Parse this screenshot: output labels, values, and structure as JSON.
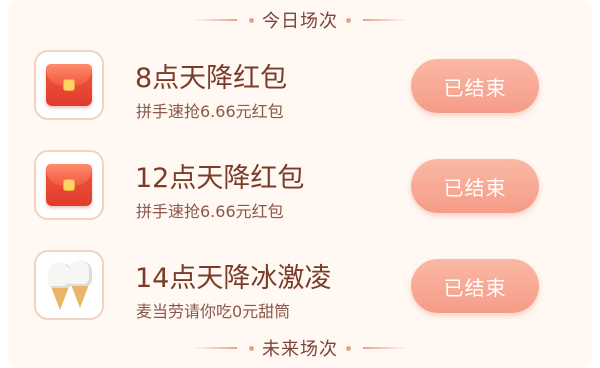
{
  "today_header": "今日场次",
  "future_header": "未来场次",
  "sessions": [
    {
      "title": "8点天降红包",
      "subtitle": "拼手速抢6.66元红包",
      "button": "已结束",
      "icon": "red-envelope-icon"
    },
    {
      "title": "12点天降红包",
      "subtitle": "拼手速抢6.66元红包",
      "button": "已结束",
      "icon": "red-envelope-icon"
    },
    {
      "title": "14点天降冰激凌",
      "subtitle": "麦当劳请你吃0元甜筒",
      "button": "已结束",
      "icon": "ice-cream-icon"
    }
  ],
  "colors": {
    "accent": "#f59c88",
    "title": "#7a3b28",
    "background": "#fff8f3"
  }
}
